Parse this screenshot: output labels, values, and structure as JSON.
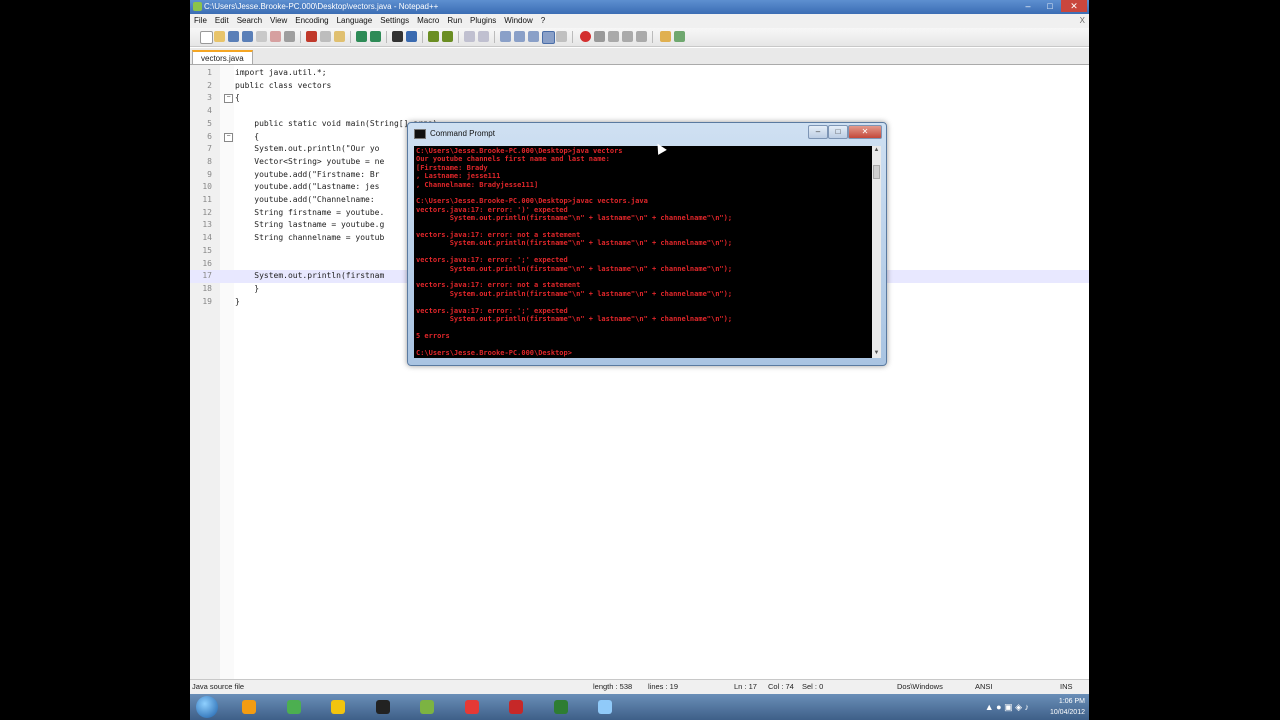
{
  "window": {
    "title": "C:\\Users\\Jesse.Brooke-PC.000\\Desktop\\vectors.java - Notepad++",
    "min": "–",
    "max": "□",
    "close": "✕"
  },
  "menu": {
    "items": [
      "File",
      "Edit",
      "Search",
      "View",
      "Encoding",
      "Language",
      "Settings",
      "Macro",
      "Run",
      "Plugins",
      "Window",
      "?"
    ],
    "close": "X"
  },
  "tab": {
    "label": "vectors.java"
  },
  "editor": {
    "lines": [
      {
        "n": "1",
        "code": "import java.util.*;"
      },
      {
        "n": "2",
        "code": "public class vectors"
      },
      {
        "n": "3",
        "code": "{"
      },
      {
        "n": "4",
        "code": ""
      },
      {
        "n": "5",
        "code": "    public static void main(String[] args)"
      },
      {
        "n": "6",
        "code": "    {"
      },
      {
        "n": "7",
        "code": "    System.out.println(\"Our yo"
      },
      {
        "n": "8",
        "code": "    Vector<String> youtube = ne"
      },
      {
        "n": "9",
        "code": "    youtube.add(\"Firstname: Br"
      },
      {
        "n": "10",
        "code": "    youtube.add(\"Lastname: jes"
      },
      {
        "n": "11",
        "code": "    youtube.add(\"Channelname: "
      },
      {
        "n": "12",
        "code": "    String firstname = youtube."
      },
      {
        "n": "13",
        "code": "    String lastname = youtube.g"
      },
      {
        "n": "14",
        "code": "    String channelname = youtub"
      },
      {
        "n": "15",
        "code": ""
      },
      {
        "n": "16",
        "code": ""
      },
      {
        "n": "17",
        "code": "    System.out.println(firstnam"
      },
      {
        "n": "18",
        "code": "    }"
      },
      {
        "n": "19",
        "code": "}"
      }
    ],
    "current_line": "17"
  },
  "status": {
    "file_type": "Java source file",
    "length": "length : 538",
    "lines": "lines : 19",
    "ln": "Ln : 17",
    "col": "Col : 74",
    "sel": "Sel : 0",
    "eol": "Dos\\Windows",
    "encoding": "ANSI",
    "mode": "INS"
  },
  "cmd": {
    "title": "Command Prompt",
    "lines": [
      "C:\\Users\\Jesse.Brooke-PC.000\\Desktop>java vectors",
      "Our youtube channels first name and last name:",
      "[Firstname: Brady",
      ", Lastname: jesse111",
      ", Channelname: Bradyjesse111]",
      "",
      "C:\\Users\\Jesse.Brooke-PC.000\\Desktop>javac vectors.java",
      "vectors.java:17: error: ')' expected",
      "        System.out.println(firstname\"\\n\" + lastname\"\\n\" + channelname\"\\n\");",
      "",
      "vectors.java:17: error: not a statement",
      "        System.out.println(firstname\"\\n\" + lastname\"\\n\" + channelname\"\\n\");",
      "",
      "vectors.java:17: error: ';' expected",
      "        System.out.println(firstname\"\\n\" + lastname\"\\n\" + channelname\"\\n\");",
      "",
      "vectors.java:17: error: not a statement",
      "        System.out.println(firstname\"\\n\" + lastname\"\\n\" + channelname\"\\n\");",
      "",
      "vectors.java:17: error: ';' expected",
      "        System.out.println(firstname\"\\n\" + lastname\"\\n\" + channelname\"\\n\");",
      "",
      "5 errors",
      "",
      "C:\\Users\\Jesse.Brooke-PC.000\\Desktop>"
    ],
    "min": "–",
    "max": "□",
    "close": "✕",
    "text_color": "#e0262a"
  },
  "taskbar": {
    "apps": [
      {
        "icon": "media-player-icon",
        "color": "#f39c12"
      },
      {
        "icon": "chrome-icon",
        "color": "#4caf50"
      },
      {
        "icon": "folder-icon",
        "color": "#f1c40f"
      },
      {
        "icon": "cmd-icon",
        "color": "#222222"
      },
      {
        "icon": "notepadpp-icon",
        "color": "#7cb342"
      },
      {
        "icon": "ccleaner-icon",
        "color": "#e53935"
      },
      {
        "icon": "malwarebytes-icon",
        "color": "#c62828"
      },
      {
        "icon": "monitor-icon",
        "color": "#2e7d32"
      },
      {
        "icon": "notepad-icon",
        "color": "#90caf9"
      }
    ],
    "time": "1:06 PM",
    "date": "10/04/2012"
  }
}
